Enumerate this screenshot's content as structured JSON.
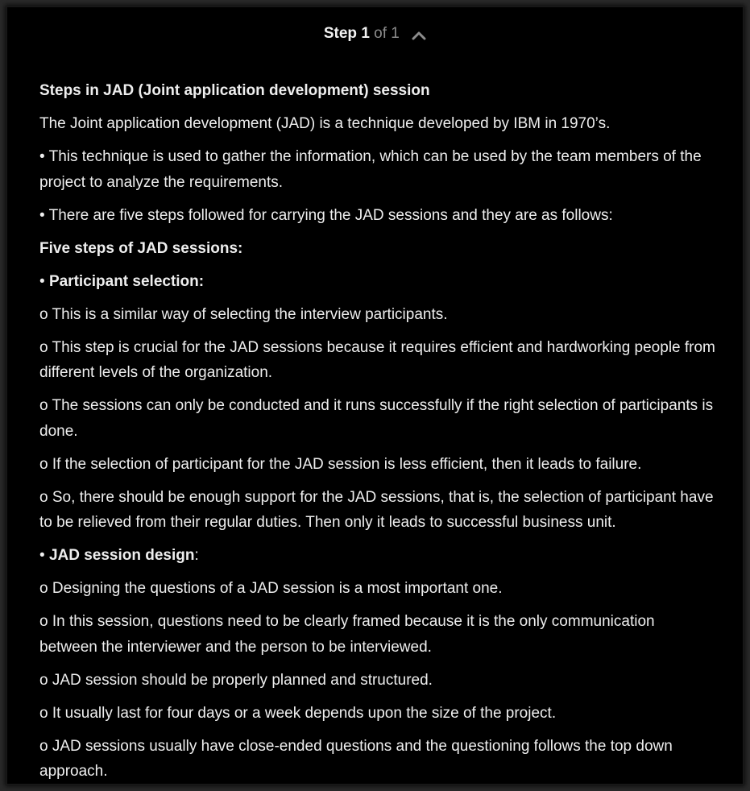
{
  "header": {
    "step_label": "Step",
    "step_current": "1",
    "step_of": "of 1"
  },
  "content": {
    "title": "Steps in JAD (Joint application development) session",
    "intro": "The Joint application development (JAD) is a technique developed by IBM in 1970’s.",
    "bullet1": "• This technique is used to gather the information, which can be used by the team members of the project to analyze the requirements.",
    "bullet2": "• There are five steps followed for carrying the JAD sessions and they are as follows:",
    "five_steps_heading": "Five steps of JAD sessions:",
    "participant_bullet": "• ",
    "participant_heading": "Participant selection:",
    "p1": "o This is a similar way of selecting the interview participants.",
    "p2": "o This step is crucial for the JAD sessions because it requires efficient and hardworking people from different levels of the organization.",
    "p3": "o The sessions can only be conducted and it runs successfully if the right selection of participants is done.",
    "p4": "o If the selection of participant for the JAD session is less efficient, then it leads to failure.",
    "p5": "o So, there should be enough support for the JAD sessions, that is, the selection of participant have to be relieved from their regular duties. Then only it leads to successful business unit.",
    "design_bullet": "• ",
    "design_heading": "JAD session design",
    "design_colon": ":",
    "d1": "o Designing the questions of a JAD session is a most important one.",
    "d2": "o In this session, questions need to be clearly framed because it is the only communication between the interviewer and the person to be interviewed.",
    "d3": "o JAD session should be properly planned and structured.",
    "d4": "o It usually last for four days or a week depends upon the size of the project.",
    "d5": "o JAD sessions usually have close-ended questions and the questioning follows the top down approach."
  },
  "icons": {
    "collapse": "chevron-up-icon"
  },
  "colors": {
    "background": "#000000",
    "text": "#eeeeee",
    "muted": "#8c8c8c"
  }
}
